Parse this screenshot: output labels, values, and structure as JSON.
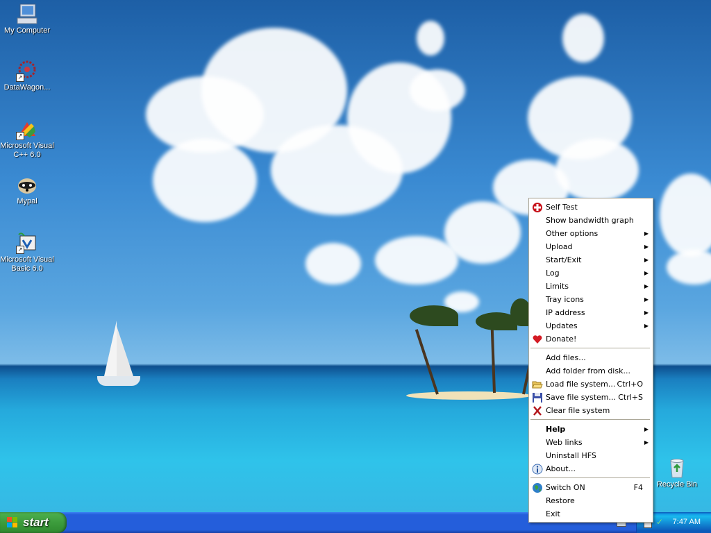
{
  "desktop": {
    "icons": [
      {
        "label": "My Computer",
        "icon": "computer-icon"
      },
      {
        "label": "DataWagon...",
        "icon": "datawagon-icon"
      },
      {
        "label": "Microsoft Visual C++ 6.0",
        "icon": "visual-cpp-icon"
      },
      {
        "label": "Mypal",
        "icon": "mypal-raccoon-icon"
      },
      {
        "label": "Microsoft Visual Basic 6.0",
        "icon": "visual-basic-icon"
      },
      {
        "label": "Recycle Bin",
        "icon": "recycle-bin-icon"
      }
    ]
  },
  "taskbar": {
    "start_label": "start",
    "clock": "7:47 AM"
  },
  "menu": {
    "items": [
      {
        "label": "Self Test",
        "icon": "red-cross-icon"
      },
      {
        "label": "Show bandwidth graph"
      },
      {
        "label": "Other options",
        "submenu": true
      },
      {
        "label": "Upload",
        "submenu": true
      },
      {
        "label": "Start/Exit",
        "submenu": true
      },
      {
        "label": "Log",
        "submenu": true
      },
      {
        "label": "Limits",
        "submenu": true
      },
      {
        "label": "Tray icons",
        "submenu": true
      },
      {
        "label": "IP address",
        "submenu": true
      },
      {
        "label": "Updates",
        "submenu": true
      },
      {
        "label": "Donate!",
        "icon": "heart-icon"
      },
      {
        "label": "Add files..."
      },
      {
        "label": "Add folder from disk..."
      },
      {
        "label": "Load file system...",
        "shortcut": "Ctrl+O",
        "icon": "open-folder-icon"
      },
      {
        "label": "Save file system...",
        "shortcut": "Ctrl+S",
        "icon": "floppy-disk-icon"
      },
      {
        "label": "Clear file system",
        "icon": "red-x-icon"
      },
      {
        "label": "Help",
        "submenu": true,
        "bold": true
      },
      {
        "label": "Web links",
        "submenu": true
      },
      {
        "label": "Uninstall HFS"
      },
      {
        "label": "About...",
        "icon": "info-icon"
      },
      {
        "label": "Switch ON",
        "shortcut": "F4",
        "icon": "globe-icon"
      },
      {
        "label": "Restore"
      },
      {
        "label": "Exit"
      }
    ]
  }
}
